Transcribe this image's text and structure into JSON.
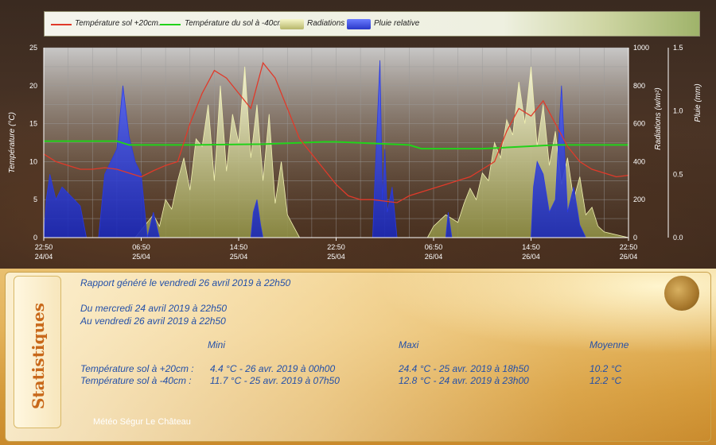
{
  "chart_data": {
    "type": "line",
    "legend_position": "top",
    "legend": [
      {
        "label": "Température sol +20cm.",
        "color": "#e03a2a",
        "kind": "line"
      },
      {
        "label": "Température du sol à -40cm",
        "color": "#22d21a",
        "kind": "line"
      },
      {
        "label": "Radiations",
        "color": "#e8e8a0",
        "kind": "area"
      },
      {
        "label": "Pluie relative",
        "color": "#3a4ee6",
        "kind": "area"
      }
    ],
    "x_ticks": [
      {
        "time": "22:50",
        "date": "24/04"
      },
      {
        "time": "06:50",
        "date": "25/04"
      },
      {
        "time": "14:50",
        "date": "25/04"
      },
      {
        "time": "22:50",
        "date": "25/04"
      },
      {
        "time": "06:50",
        "date": "26/04"
      },
      {
        "time": "14:50",
        "date": "26/04"
      },
      {
        "time": "22:50",
        "date": "26/04"
      }
    ],
    "y_left": {
      "label": "Température (°C)",
      "min": 0,
      "max": 25,
      "ticks": [
        "0",
        "5",
        "10",
        "15",
        "20",
        "25"
      ]
    },
    "y_right1": {
      "label": "Radiations (w/m²)",
      "min": 0,
      "max": 1000,
      "ticks": [
        "0",
        "200",
        "400",
        "600",
        "800",
        "1000"
      ]
    },
    "y_right2": {
      "label": "Pluie (mm)",
      "min": 0,
      "max": 1.5,
      "ticks": [
        "0.0",
        "0.5",
        "1.0",
        "1.5"
      ]
    },
    "grid": true,
    "hours": 48,
    "series": [
      {
        "name": "Température sol +20cm.",
        "axis": "left",
        "color": "#e03a2a",
        "t": [
          0,
          1,
          2,
          3,
          4,
          5,
          6,
          7,
          8,
          9,
          10,
          11,
          12,
          13,
          14,
          15,
          16,
          17,
          18,
          19,
          20,
          21,
          22,
          23,
          24,
          25,
          26,
          27,
          28,
          29,
          30,
          31,
          32,
          33,
          34,
          35,
          36,
          37,
          38,
          39,
          40,
          41,
          42,
          43,
          44,
          45,
          46,
          47,
          48
        ],
        "values": [
          11,
          10,
          9.5,
          9,
          9,
          9.2,
          9,
          8.5,
          8,
          8.8,
          9.5,
          10,
          15,
          19,
          22,
          21,
          19,
          17,
          23,
          21,
          17,
          13,
          11,
          9,
          7,
          5.5,
          5,
          5,
          4.8,
          4.6,
          5.5,
          6,
          6.5,
          7,
          7.5,
          8,
          9,
          10,
          14,
          17,
          16,
          18,
          15,
          12,
          10,
          9,
          8.5,
          8,
          8.2
        ]
      },
      {
        "name": "Température du sol à -40cm",
        "axis": "left",
        "color": "#22d21a",
        "t": [
          0,
          6,
          7,
          12,
          18,
          23,
          24,
          30,
          31,
          36,
          42,
          48
        ],
        "values": [
          12.7,
          12.7,
          12.2,
          12.2,
          12.3,
          12.6,
          12.6,
          12.2,
          11.7,
          11.7,
          12.2,
          12.2
        ]
      },
      {
        "name": "Radiations",
        "axis": "right1",
        "color": "#e8e8a0",
        "t": [
          0,
          7.5,
          8,
          9,
          9.5,
          10,
          10.5,
          11,
          11.5,
          12,
          12.5,
          13,
          13.5,
          14,
          14.5,
          15,
          15.5,
          16,
          16.5,
          17,
          17.5,
          18,
          18.5,
          19,
          19.5,
          20,
          20.5,
          21,
          31.5,
          32,
          33,
          34,
          34.5,
          35,
          35.5,
          36,
          36.5,
          37,
          37.5,
          38,
          38.5,
          39,
          39.5,
          40,
          40.5,
          41,
          41.5,
          42,
          42.5,
          43,
          43.5,
          44,
          44.5,
          45,
          45.5,
          46,
          48
        ],
        "values": [
          0,
          0,
          40,
          120,
          60,
          200,
          150,
          300,
          420,
          250,
          520,
          480,
          700,
          300,
          800,
          350,
          650,
          500,
          900,
          420,
          700,
          300,
          650,
          180,
          400,
          120,
          60,
          0,
          0,
          60,
          120,
          80,
          180,
          260,
          200,
          340,
          300,
          500,
          420,
          620,
          540,
          820,
          600,
          900,
          480,
          700,
          380,
          560,
          280,
          420,
          200,
          320,
          120,
          160,
          60,
          30,
          0
        ]
      },
      {
        "name": "Pluie relative",
        "axis": "right2",
        "color": "#3a4ee6",
        "t": [
          0,
          0.2,
          0.5,
          1,
          1.5,
          2,
          2.5,
          3,
          3.5,
          4,
          4.5,
          5,
          5.5,
          6,
          6.5,
          7,
          7.5,
          8,
          8.5,
          9,
          9.5,
          10,
          17,
          17.2,
          17.5,
          17.8,
          18,
          21,
          27,
          27.2,
          27.6,
          27.8,
          28,
          28.2,
          28.6,
          29,
          33,
          33.2,
          33.5,
          36,
          40,
          40.2,
          40.5,
          41,
          41.5,
          42,
          42.5,
          43,
          43.5,
          44,
          44.5,
          48
        ],
        "values": [
          0,
          0.3,
          0.5,
          0.3,
          0.4,
          0.35,
          0.3,
          0.25,
          0,
          0,
          0,
          0.5,
          0.6,
          0.7,
          1.2,
          0.8,
          0.6,
          0.5,
          0,
          0.2,
          0,
          0,
          0,
          0.2,
          0.3,
          0.1,
          0,
          0,
          0,
          0.5,
          1.4,
          0.3,
          0.7,
          0.2,
          0.4,
          0,
          0,
          0.2,
          0,
          0,
          0,
          0.4,
          0.6,
          0.5,
          0.2,
          0.3,
          1.2,
          0.2,
          0.4,
          0.1,
          0,
          0
        ]
      }
    ]
  },
  "stats": {
    "tab_label": "Statistiques",
    "report_line": "Rapport généré le vendredi 26 avril 2019 à 22h50",
    "period_from": "Du mercredi 24 avril 2019 à 22h50",
    "period_to": "Au vendredi 26 avril 2019 à 22h50",
    "col_mini": "Mini",
    "col_maxi": "Maxi",
    "col_moyenne": "Moyenne",
    "rows": [
      {
        "label": "Température sol à +20cm :",
        "mini": "4.4 °C - 26 avr. 2019 à 00h00",
        "maxi": "24.4 °C - 25 avr. 2019 à 18h50",
        "moyenne": "10.2 °C"
      },
      {
        "label": "Température sol à -40cm :",
        "mini": "11.7 °C - 25 avr. 2019 à 07h50",
        "maxi": "12.8 °C - 24 avr. 2019 à 23h00",
        "moyenne": "12.2 °C"
      }
    ],
    "footer": "Météo Ségur Le Château"
  }
}
